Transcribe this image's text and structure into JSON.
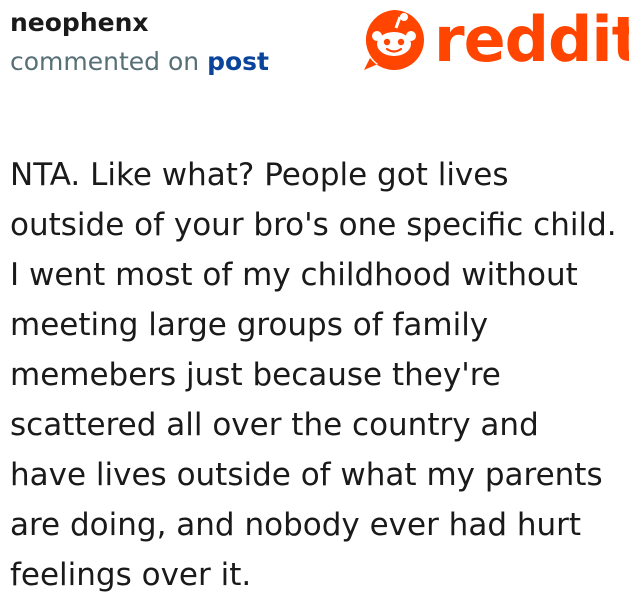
{
  "author": {
    "username": "neophenx",
    "action_text": "commented on ",
    "target_link": "post"
  },
  "brand": {
    "name": "reddit",
    "icon": "reddit-alien-icon",
    "color": "#ff4500"
  },
  "comment": {
    "text": "NTA. Like what? People got lives outside of your bro's one specific child. I went most of my childhood without meeting large groups of family memebers just because they're scattered all over the country and have lives outside of what my parents are doing, and nobody ever had hurt feelings over it."
  }
}
